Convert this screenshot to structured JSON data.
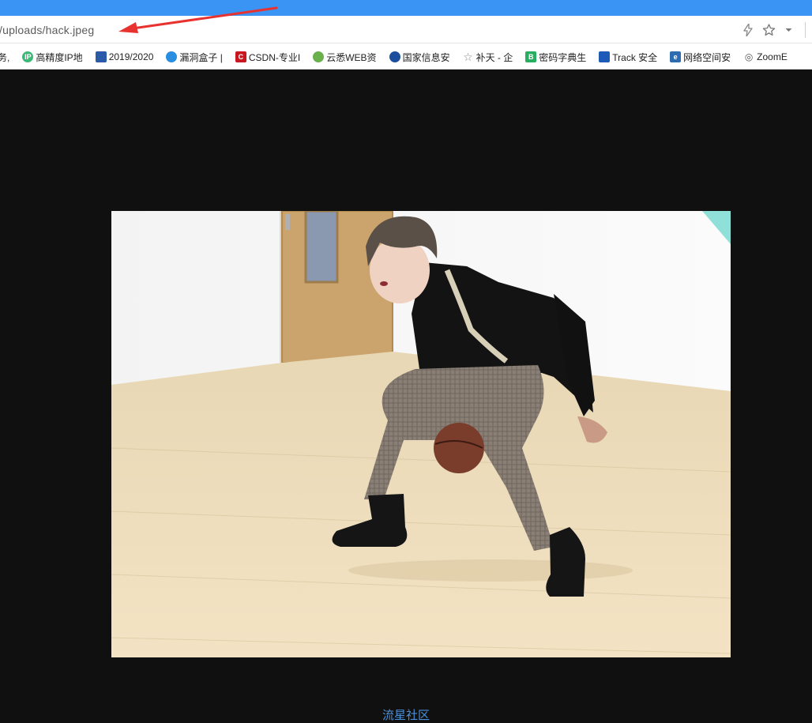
{
  "address_bar": {
    "url": "/uploads/hack.jpeg",
    "icons": [
      "lightning-icon",
      "star-icon",
      "chevron-down-icon"
    ]
  },
  "bookmarks": [
    {
      "label": "务,",
      "icon": "none"
    },
    {
      "label": "高精度IP地",
      "icon": "ip-icon",
      "color": "#3cb878"
    },
    {
      "label": "2019/2020",
      "icon": "flag-icon",
      "color": "#2b5aa8"
    },
    {
      "label": "漏洞盒子 |",
      "icon": "hexagon-icon",
      "color": "#2a8ee0"
    },
    {
      "label": "CSDN-专业I",
      "icon": "csdn-icon",
      "color": "#c9171f"
    },
    {
      "label": "云悉WEB资",
      "icon": "yunxi-icon",
      "color": "#6ab04c"
    },
    {
      "label": "国家信息安",
      "icon": "globe-icon",
      "color": "#1d4e9e"
    },
    {
      "label": "补天 - 企",
      "icon": "star-outline-icon",
      "color": "#888888"
    },
    {
      "label": "密码字典生",
      "icon": "b-icon",
      "color": "#27ae60"
    },
    {
      "label": "Track 安全",
      "icon": "shield-icon",
      "color": "#1e5bb8"
    },
    {
      "label": "网络空间安",
      "icon": "e-icon",
      "color": "#2d6cb0"
    },
    {
      "label": "ZoomE",
      "icon": "eye-icon",
      "color": "#555555"
    }
  ],
  "image": {
    "subject": "person dribbling basketball in a dance studio"
  },
  "footer": {
    "link_text": "流星社区",
    "link_color": "#4a90d9"
  },
  "colors": {
    "titlebar": "#3a94f3",
    "annotation_arrow": "#e8322f",
    "page_background": "#101010"
  }
}
